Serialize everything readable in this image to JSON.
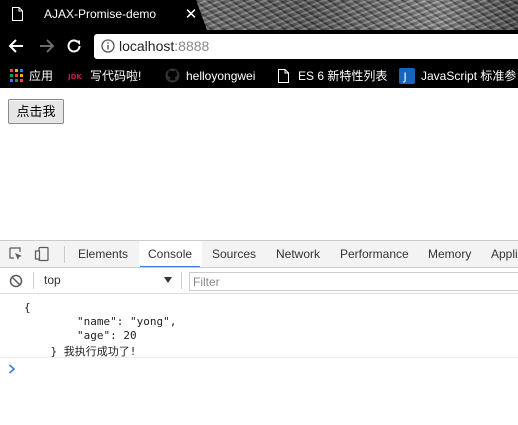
{
  "tab": {
    "title": "AJAX-Promise-demo",
    "close_glyph": "✕",
    "icon": "document-icon"
  },
  "toolbar": {
    "url_host": "localhost",
    "url_port": ":8888"
  },
  "bookmarks": {
    "items": [
      {
        "label": "应用",
        "icon": "apps-grid-icon"
      },
      {
        "label": "写代码啦!",
        "icon": "coding-site-icon"
      },
      {
        "label": "helloyongwei",
        "icon": "github-icon"
      },
      {
        "label": "ES 6 新特性列表",
        "icon": "document-icon"
      },
      {
        "label": "JavaScript 标准参",
        "icon": "j-icon"
      }
    ]
  },
  "page": {
    "button_label": "点击我"
  },
  "devtools": {
    "tabs": [
      "Elements",
      "Console",
      "Sources",
      "Network",
      "Performance",
      "Memory",
      "Appli"
    ],
    "active_tab": "Console",
    "context": "top",
    "filter_placeholder": "Filter",
    "output": {
      "line1": "{",
      "line2": "        \"name\": \"yong\",",
      "line3": "        \"age\": 20",
      "line4": "    } 我执行成功了!"
    },
    "prompt_glyph": "›"
  },
  "colors": {
    "accent_blue": "#3b78e7",
    "prompt_blue": "#3b78e7",
    "chrome_dark": "#000000",
    "devtools_bg": "#f3f3f3"
  }
}
